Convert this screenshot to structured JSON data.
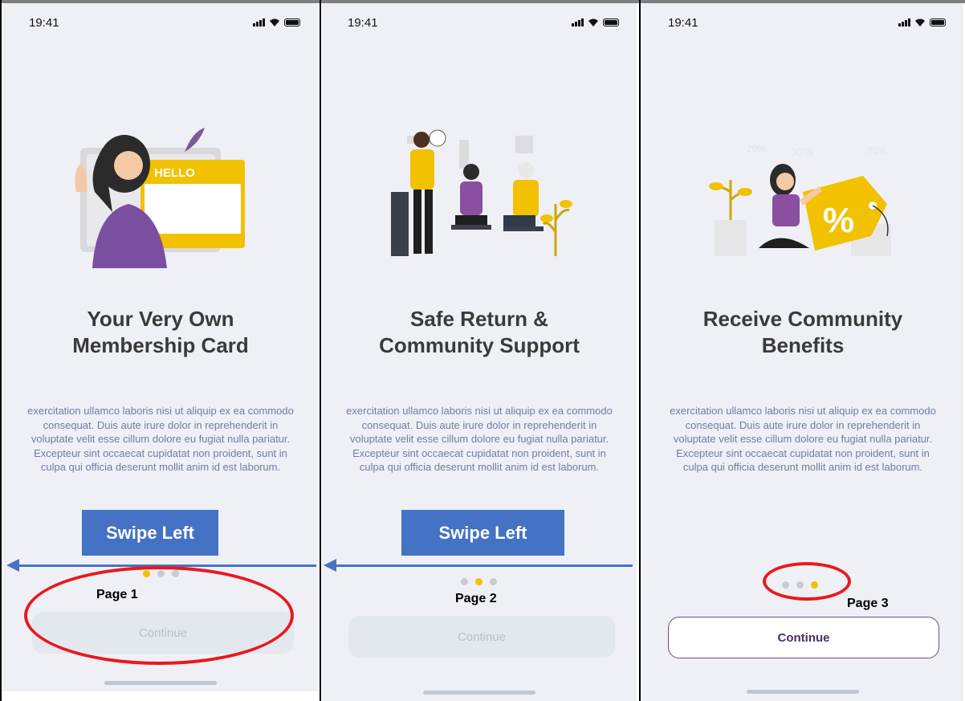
{
  "status_time": "19:41",
  "screens": [
    {
      "title_line1": "Your Very Own",
      "title_line2": "Membership Card",
      "illustration_label": "HELLO",
      "body": "exercitation ullamco laboris nisi ut aliquip ex ea commodo consequat. Duis aute irure dolor in reprehenderit in voluptate velit esse cillum dolore eu fugiat nulla pariatur. Excepteur sint occaecat cupidatat non proident, sunt in culpa qui officia deserunt mollit anim id est laborum.",
      "active_dot": 1,
      "continue_label": "Continue",
      "continue_enabled": false
    },
    {
      "title_line1": "Safe Return &",
      "title_line2": "Community Support",
      "body": "exercitation ullamco laboris nisi ut aliquip ex ea commodo consequat. Duis aute irure dolor in reprehenderit in voluptate velit esse cillum dolore eu fugiat nulla pariatur. Excepteur sint occaecat cupidatat non proident, sunt in culpa qui officia deserunt mollit anim id est laborum.",
      "active_dot": 2,
      "continue_label": "Continue",
      "continue_enabled": false
    },
    {
      "title_line1": "Receive Community",
      "title_line2": "Benefits",
      "illustration_label": "%",
      "illustration_tags": [
        "20%",
        "30%",
        "75%"
      ],
      "body": "exercitation ullamco laboris nisi ut aliquip ex ea commodo consequat. Duis aute irure dolor in reprehenderit in voluptate velit esse cillum dolore eu fugiat nulla pariatur. Excepteur sint occaecat cupidatat non proident, sunt in culpa qui officia deserunt mollit anim id est laborum.",
      "active_dot": 3,
      "continue_label": "Continue",
      "continue_enabled": true
    }
  ],
  "annotations": {
    "swipe_label": "Swipe Left",
    "page_labels": [
      "Page 1",
      "Page 2",
      "Page 3"
    ]
  },
  "colors": {
    "accent_yellow": "#f2c100",
    "swipe_blue": "#4472c4",
    "highlight_red": "#e8191d",
    "continue_purple": "#4b2e64"
  }
}
